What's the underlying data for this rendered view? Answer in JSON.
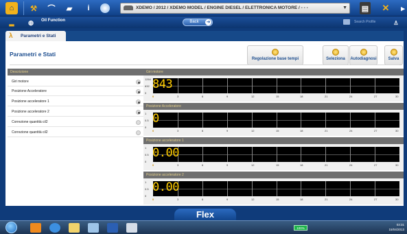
{
  "toolbar": {
    "path": "XDEMO / 2012 / XDEMO MODEL / ENGINE DIESEL / ELETTRONICA MOTORE / - - -",
    "search_placeholder": "Search Profile"
  },
  "subbar": {
    "function_label": "Oil Function",
    "back_label": "Back"
  },
  "tab": {
    "label": "Parametri e Stati"
  },
  "panel": {
    "title": "Parametri e Stati",
    "buttons": {
      "timebase": "Regolazione base tempi",
      "select": "Seleziona",
      "autodiag": "Autodiagnosi",
      "save": "Salva"
    }
  },
  "list": {
    "header": "Descrizione",
    "items": [
      {
        "label": "Giri motore",
        "selected": true
      },
      {
        "label": "Posizione Acceleratore",
        "selected": true
      },
      {
        "label": "Posizione acceleratore 1",
        "selected": true
      },
      {
        "label": "Posizione acceleratore 2",
        "selected": true
      },
      {
        "label": "Correzione quantità cil2",
        "selected": false
      },
      {
        "label": "Correzione quantità cil2",
        "selected": false
      }
    ]
  },
  "charts": [
    {
      "title": "Giri motore",
      "value": "843",
      "ymax": "1264",
      "ymid": "632",
      "ymin": "0"
    },
    {
      "title": "Posizione Acceleratore",
      "value": "0",
      "ymax": "1",
      "ymid": "0.5",
      "ymin": "0"
    },
    {
      "title": "Posizione acceleratore 1",
      "value": "0.00",
      "ymax": "1",
      "ymid": "0.5",
      "ymin": "0"
    },
    {
      "title": "Posizione acceleratore 2",
      "value": "0.00",
      "ymax": "1",
      "ymid": "0.5",
      "ymin": "0"
    }
  ],
  "xticks": [
    "0",
    "3",
    "6",
    "9",
    "12",
    "15",
    "18",
    "21",
    "24",
    "27",
    "30"
  ],
  "footer": {
    "label": "Flex"
  },
  "taskbar": {
    "battery": "100%",
    "time": "03:31",
    "date": "15/04/2013"
  }
}
